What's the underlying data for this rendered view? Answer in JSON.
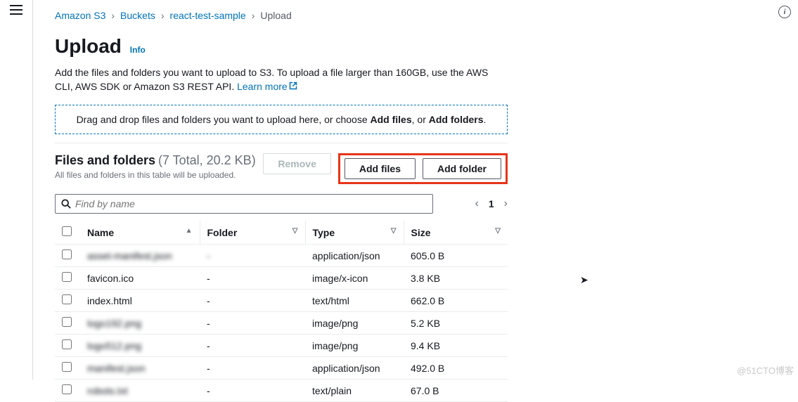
{
  "breadcrumb": {
    "root": "Amazon S3",
    "lvl1": "Buckets",
    "lvl2": "react-test-sample",
    "current": "Upload"
  },
  "header": {
    "title": "Upload",
    "info": "Info",
    "description_prefix": "Add the files and folders you want to upload to S3. To upload a file larger than 160GB, use the AWS CLI, AWS SDK or Amazon S3 REST API. ",
    "learn_more": "Learn more"
  },
  "dropzone": {
    "prefix": "Drag and drop files and folders you want to upload here, or choose ",
    "bold1": "Add files",
    "mid": ", or ",
    "bold2": "Add folders",
    "suffix": "."
  },
  "panel": {
    "title": "Files and folders",
    "count": "(7 Total, 20.2 KB)",
    "subtitle": "All files and folders in this table will be uploaded.",
    "remove": "Remove",
    "add_files": "Add files",
    "add_folder": "Add folder"
  },
  "search": {
    "placeholder": "Find by name"
  },
  "pager": {
    "page": "1"
  },
  "columns": {
    "name": "Name",
    "folder": "Folder",
    "type": "Type",
    "size": "Size"
  },
  "rows": [
    {
      "name": "asset-manifest.json",
      "folder": "-",
      "type": "application/json",
      "size": "605.0 B",
      "blur_name": true,
      "blur_folder": true
    },
    {
      "name": "favicon.ico",
      "folder": "-",
      "type": "image/x-icon",
      "size": "3.8 KB",
      "blur_name": false,
      "blur_folder": false
    },
    {
      "name": "index.html",
      "folder": "-",
      "type": "text/html",
      "size": "662.0 B",
      "blur_name": false,
      "blur_folder": false
    },
    {
      "name": "logo192.png",
      "folder": "-",
      "type": "image/png",
      "size": "5.2 KB",
      "blur_name": true,
      "blur_folder": false
    },
    {
      "name": "logo512.png",
      "folder": "-",
      "type": "image/png",
      "size": "9.4 KB",
      "blur_name": true,
      "blur_folder": false
    },
    {
      "name": "manifest.json",
      "folder": "-",
      "type": "application/json",
      "size": "492.0 B",
      "blur_name": true,
      "blur_folder": false
    },
    {
      "name": "robots.txt",
      "folder": "-",
      "type": "text/plain",
      "size": "67.0 B",
      "blur_name": true,
      "blur_folder": false
    }
  ],
  "watermark": "@51CTO博客"
}
